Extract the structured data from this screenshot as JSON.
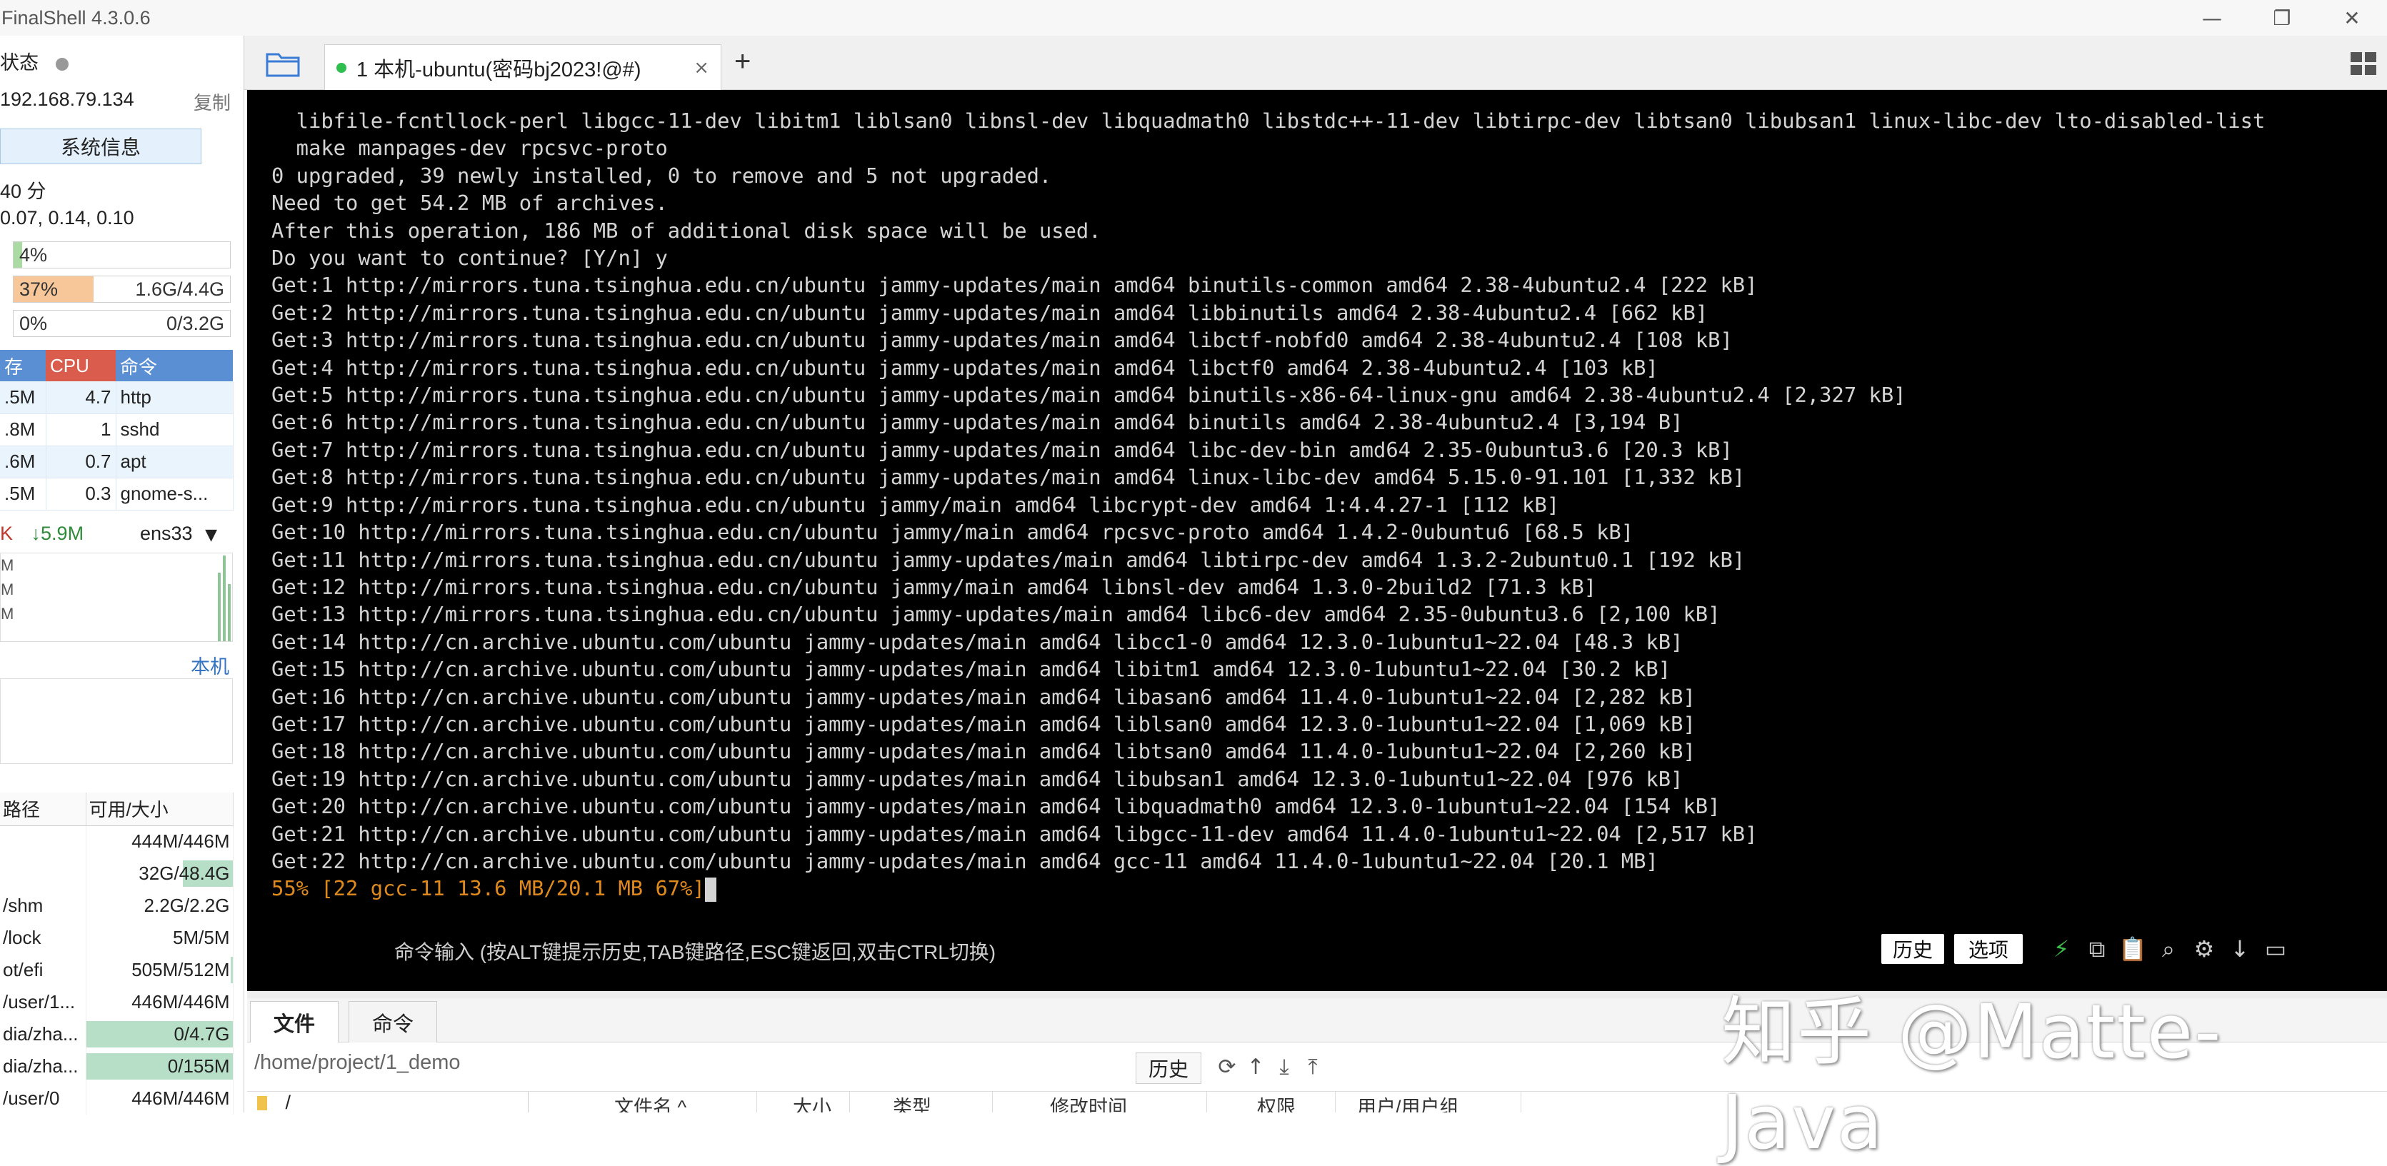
{
  "window": {
    "title": "FinalShell 4.3.0.6",
    "minimize_glyph": "—",
    "restore_glyph": "❐",
    "close_glyph": "✕"
  },
  "sidebar": {
    "status_label": "状态",
    "ip": "192.168.79.134",
    "copy_label": "复制",
    "sysinfo_label": "系统信息",
    "uptime": "40 分",
    "load": "0.07, 0.14, 0.10",
    "cpu_meter": {
      "percent": "4%",
      "fraction": 0.04
    },
    "mem_meter": {
      "percent": "37%",
      "size": "1.6G/4.4G",
      "fraction": 0.37
    },
    "swap_meter": {
      "percent": "0%",
      "size": "0/3.2G",
      "fraction": 0.0
    },
    "process_table": {
      "headers": [
        "存",
        "CPU",
        "命令"
      ],
      "rows": [
        {
          "mem": ".5M",
          "cpu": "4.7",
          "cmd": "http"
        },
        {
          "mem": ".8M",
          "cpu": "1",
          "cmd": "sshd"
        },
        {
          "mem": ".6M",
          "cpu": "0.7",
          "cmd": "apt"
        },
        {
          "mem": ".5M",
          "cpu": "0.3",
          "cmd": "gnome-s..."
        }
      ]
    },
    "network": {
      "up": "K",
      "down": "↓5.9M",
      "interface": "ens33",
      "graph_labels": [
        "M",
        "M",
        "M"
      ]
    },
    "local_link": "本机",
    "disk_table": {
      "headers": [
        "路径",
        "可用/大小"
      ],
      "rows": [
        {
          "path": "",
          "size": "444M/446M",
          "used_fraction": 0.0
        },
        {
          "path": "",
          "size": "32G/48.4G",
          "used_fraction": 0.34
        },
        {
          "path": "/shm",
          "size": "2.2G/2.2G",
          "used_fraction": 0.0
        },
        {
          "path": "/lock",
          "size": "5M/5M",
          "used_fraction": 0.0
        },
        {
          "path": "ot/efi",
          "size": "505M/512M",
          "used_fraction": 0.01
        },
        {
          "path": "/user/1...",
          "size": "446M/446M",
          "used_fraction": 0.0
        },
        {
          "path": "dia/zha...",
          "size": "0/4.7G",
          "used_fraction": 1.0
        },
        {
          "path": "dia/zha...",
          "size": "0/155M",
          "used_fraction": 1.0
        },
        {
          "path": "/user/0",
          "size": "446M/446M",
          "used_fraction": 0.0
        }
      ]
    }
  },
  "tabs": {
    "active_tab_label": "1 本机-ubuntu(密码bj2023!@#)",
    "close_glyph": "×",
    "add_glyph": "+"
  },
  "terminal": {
    "lines": [
      "  libfile-fcntllock-perl libgcc-11-dev libitm1 liblsan0 libnsl-dev libquadmath0 libstdc++-11-dev libtirpc-dev libtsan0 libubsan1 linux-libc-dev lto-disabled-list",
      "  make manpages-dev rpcsvc-proto",
      "0 upgraded, 39 newly installed, 0 to remove and 5 not upgraded.",
      "Need to get 54.2 MB of archives.",
      "After this operation, 186 MB of additional disk space will be used.",
      "Do you want to continue? [Y/n] y",
      "Get:1 http://mirrors.tuna.tsinghua.edu.cn/ubuntu jammy-updates/main amd64 binutils-common amd64 2.38-4ubuntu2.4 [222 kB]",
      "Get:2 http://mirrors.tuna.tsinghua.edu.cn/ubuntu jammy-updates/main amd64 libbinutils amd64 2.38-4ubuntu2.4 [662 kB]",
      "Get:3 http://mirrors.tuna.tsinghua.edu.cn/ubuntu jammy-updates/main amd64 libctf-nobfd0 amd64 2.38-4ubuntu2.4 [108 kB]",
      "Get:4 http://mirrors.tuna.tsinghua.edu.cn/ubuntu jammy-updates/main amd64 libctf0 amd64 2.38-4ubuntu2.4 [103 kB]",
      "Get:5 http://mirrors.tuna.tsinghua.edu.cn/ubuntu jammy-updates/main amd64 binutils-x86-64-linux-gnu amd64 2.38-4ubuntu2.4 [2,327 kB]",
      "Get:6 http://mirrors.tuna.tsinghua.edu.cn/ubuntu jammy-updates/main amd64 binutils amd64 2.38-4ubuntu2.4 [3,194 B]",
      "Get:7 http://mirrors.tuna.tsinghua.edu.cn/ubuntu jammy-updates/main amd64 libc-dev-bin amd64 2.35-0ubuntu3.6 [20.3 kB]",
      "Get:8 http://mirrors.tuna.tsinghua.edu.cn/ubuntu jammy-updates/main amd64 linux-libc-dev amd64 5.15.0-91.101 [1,332 kB]",
      "Get:9 http://mirrors.tuna.tsinghua.edu.cn/ubuntu jammy/main amd64 libcrypt-dev amd64 1:4.4.27-1 [112 kB]",
      "Get:10 http://mirrors.tuna.tsinghua.edu.cn/ubuntu jammy/main amd64 rpcsvc-proto amd64 1.4.2-0ubuntu6 [68.5 kB]",
      "Get:11 http://mirrors.tuna.tsinghua.edu.cn/ubuntu jammy-updates/main amd64 libtirpc-dev amd64 1.3.2-2ubuntu0.1 [192 kB]",
      "Get:12 http://mirrors.tuna.tsinghua.edu.cn/ubuntu jammy/main amd64 libnsl-dev amd64 1.3.0-2build2 [71.3 kB]",
      "Get:13 http://mirrors.tuna.tsinghua.edu.cn/ubuntu jammy-updates/main amd64 libc6-dev amd64 2.35-0ubuntu3.6 [2,100 kB]",
      "Get:14 http://cn.archive.ubuntu.com/ubuntu jammy-updates/main amd64 libcc1-0 amd64 12.3.0-1ubuntu1~22.04 [48.3 kB]",
      "Get:15 http://cn.archive.ubuntu.com/ubuntu jammy-updates/main amd64 libitm1 amd64 12.3.0-1ubuntu1~22.04 [30.2 kB]",
      "Get:16 http://cn.archive.ubuntu.com/ubuntu jammy-updates/main amd64 libasan6 amd64 11.4.0-1ubuntu1~22.04 [2,282 kB]",
      "Get:17 http://cn.archive.ubuntu.com/ubuntu jammy-updates/main amd64 liblsan0 amd64 12.3.0-1ubuntu1~22.04 [1,069 kB]",
      "Get:18 http://cn.archive.ubuntu.com/ubuntu jammy-updates/main amd64 libtsan0 amd64 11.4.0-1ubuntu1~22.04 [2,260 kB]",
      "Get:19 http://cn.archive.ubuntu.com/ubuntu jammy-updates/main amd64 libubsan1 amd64 12.3.0-1ubuntu1~22.04 [976 kB]",
      "Get:20 http://cn.archive.ubuntu.com/ubuntu jammy-updates/main amd64 libquadmath0 amd64 12.3.0-1ubuntu1~22.04 [154 kB]",
      "Get:21 http://cn.archive.ubuntu.com/ubuntu jammy-updates/main amd64 libgcc-11-dev amd64 11.4.0-1ubuntu1~22.04 [2,517 kB]",
      "Get:22 http://cn.archive.ubuntu.com/ubuntu jammy-updates/main amd64 gcc-11 amd64 11.4.0-1ubuntu1~22.04 [20.1 MB]"
    ],
    "progress_line": "55% [22 gcc-11 13.6 MB/20.1 MB 67%]"
  },
  "command_bar": {
    "hint": "命令输入 (按ALT键提示历史,TAB键路径,ESC键返回,双击CTRL切换)",
    "history_label": "历史",
    "options_label": "选项"
  },
  "bottom_tabs": [
    "文件",
    "命令"
  ],
  "file_panel": {
    "path": "/home/project/1_demo",
    "history_label": "历史",
    "tree_root": "/",
    "columns": [
      "文件名 ^",
      "大小",
      "类型",
      "修改时间",
      "权限",
      "用户/用户组"
    ]
  },
  "watermark": "知乎 @Matte-Java",
  "colors": {
    "terminal_bg": "#000000",
    "terminal_fg": "#d4d4d4",
    "progress_orange": "#e08a1e",
    "cpu_header": "#d95c4c",
    "table_header": "#5b8fd3",
    "status_green": "#2fbf4f"
  }
}
